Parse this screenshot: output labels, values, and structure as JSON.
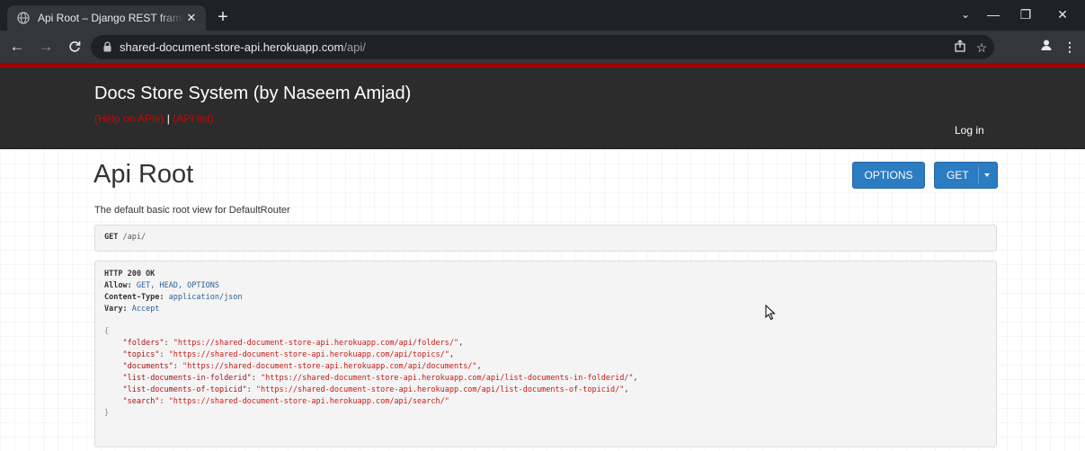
{
  "browser": {
    "tab_title": "Api Root – Django REST framewo",
    "tab_close": "✕",
    "new_tab": "+",
    "url_host": "shared-document-store-api.herokuapp.com",
    "url_path": "/api/",
    "window_buttons": {
      "dropdown": "⌄",
      "minimize": "—",
      "restore": "❐",
      "close": "✕"
    }
  },
  "navbar": {
    "brand": "Docs Store System (by Naseem Amjad)",
    "link_help": "(Help on APIs)",
    "separator": "|",
    "link_api_list": "(API list)",
    "login": "Log in"
  },
  "page": {
    "title": "Api Root",
    "description": "The default basic root view for DefaultRouter",
    "options_button": "OPTIONS",
    "get_button": "GET"
  },
  "request": {
    "method": "GET",
    "path": "/api/"
  },
  "response": {
    "status": "HTTP 200 OK",
    "headers": [
      {
        "key": "Allow:",
        "value": "GET, HEAD, OPTIONS"
      },
      {
        "key": "Content-Type:",
        "value": "application/json"
      },
      {
        "key": "Vary:",
        "value": "Accept"
      }
    ],
    "open_brace": "{",
    "close_brace": "}",
    "body": [
      {
        "key": "\"folders\"",
        "value": "\"https://shared-document-store-api.herokuapp.com/api/folders/\""
      },
      {
        "key": "\"topics\"",
        "value": "\"https://shared-document-store-api.herokuapp.com/api/topics/\""
      },
      {
        "key": "\"documents\"",
        "value": "\"https://shared-document-store-api.herokuapp.com/api/documents/\""
      },
      {
        "key": "\"list-documents-in-folderid\"",
        "value": "\"https://shared-document-store-api.herokuapp.com/api/list-documents-in-folderid/\""
      },
      {
        "key": "\"list-documents-of-topicid\"",
        "value": "\"https://shared-document-store-api.herokuapp.com/api/list-documents-of-topicid/\""
      },
      {
        "key": "\"search\"",
        "value": "\"https://shared-document-store-api.herokuapp.com/api/search/\""
      }
    ]
  },
  "colors": {
    "browser_bg": "#202124",
    "toolbar_bg": "#35363a",
    "navbar_bg": "#2c2c2c",
    "accent_red": "#a30000",
    "link_red": "#d60000",
    "button_blue": "#2c7cc2",
    "json_string": "#c41a16"
  },
  "icons": {
    "favicon": "globe-icon",
    "back": "back-arrow-icon",
    "forward": "forward-arrow-icon",
    "reload": "reload-icon",
    "lock": "lock-icon",
    "share": "share-icon",
    "bookmark": "star-icon",
    "profile": "profile-icon",
    "menu": "kebab-menu-icon",
    "cursor": "mouse-pointer-icon"
  }
}
